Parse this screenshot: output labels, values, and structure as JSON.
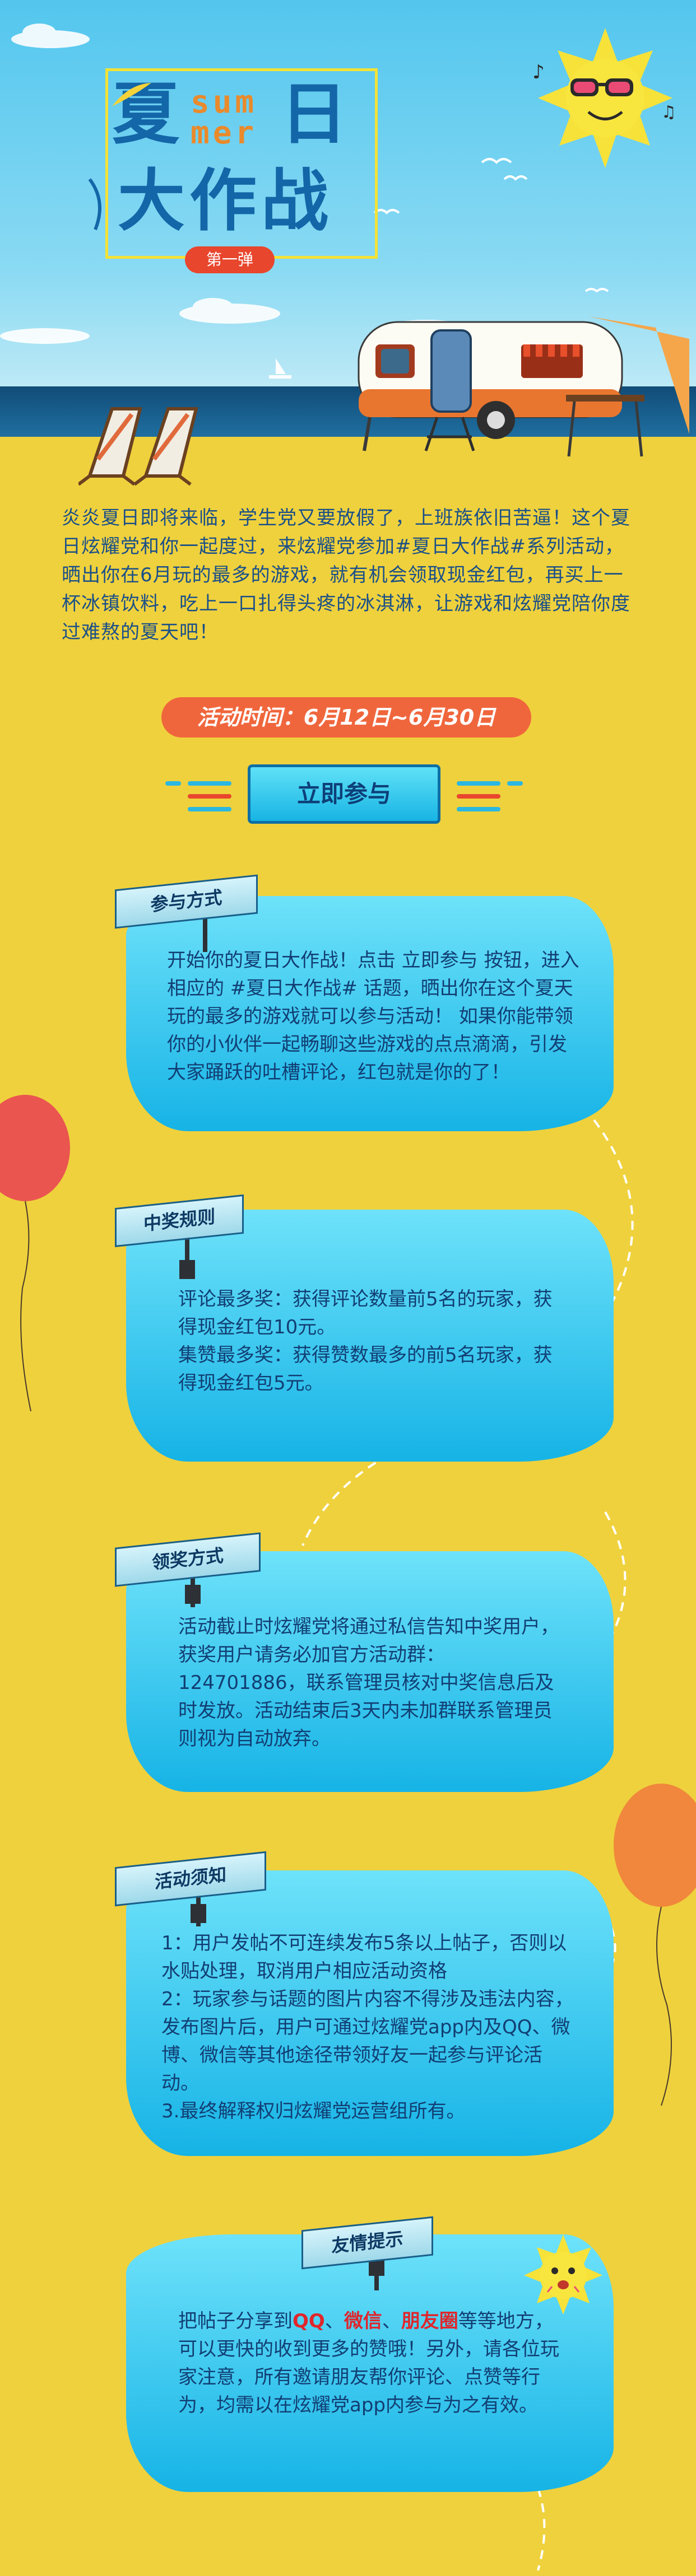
{
  "header": {
    "title_char1": "夏",
    "title_char2": "日",
    "title_line2": "大作战",
    "summer_line1": "sum",
    "summer_line2": "mer",
    "badge": "第一弹"
  },
  "intro": "炎炎夏日即将来临，学生党又要放假了，上班族依旧苦逼！这个夏日炫耀党和你一起度过，来炫耀党参加#夏日大作战#系列活动，晒出你在6月玩的最多的游戏，就有机会领取现金红包，再买上一杯冰镇饮料，吃上一口扎得头疼的冰淇淋，让游戏和炫耀党陪你度过难熬的夏天吧！",
  "activity_time": "活动时间：6月12日~6月30日",
  "join_button": "立即参与",
  "sections": [
    {
      "title": "参与方式",
      "text": "开始你的夏日大作战！点击 立即参与 按钮，进入相应的 #夏日大作战# 话题，晒出你在这个夏天玩的最多的游戏就可以参与活动！ 如果你能带领你的小伙伴一起畅聊这些游戏的点点滴滴，引发大家踊跃的吐槽评论，红包就是你的了！"
    },
    {
      "title": "中奖规则",
      "text": "评论最多奖：获得评论数量前5名的玩家，获得现金红包10元。\n集赞最多奖：获得赞数最多的前5名玩家，获得现金红包5元。"
    },
    {
      "title": "领奖方式",
      "text": "活动截止时炫耀党将通过私信告知中奖用户，获奖用户请务必加官方活动群：124701886，联系管理员核对中奖信息后及时发放。活动结束后3天内未加群联系管理员则视为自动放弃。"
    },
    {
      "title": "活动须知",
      "text": "1：用户发帖不可连续发布5条以上帖子，否则以水贴处理，取消用户相应活动资格\n2：玩家参与话题的图片内容不得涉及违法内容，发布图片后，用户可通过炫耀党app内及QQ、微博、微信等其他途径带领好友一起参与评论活动。\n3.最终解释权归炫耀党运营组所有。"
    }
  ],
  "tips": {
    "title": "友情提示",
    "text_before": "把帖子分享到",
    "channel_qq": "QQ",
    "sep1": "、",
    "channel_wechat": "微信",
    "sep2": "、",
    "channel_moments": "朋友圈",
    "text_after": "等等地方，可以更快的收到更多的赞哦！另外，请各位玩家注意，所有邀请朋友帮你评论、点赞等行为，均需以在炫耀党app内参与为之有效。"
  },
  "colors": {
    "sand": "#efd13d",
    "sky": "#53c6ee",
    "panel": "#2cc4ee",
    "title_blue": "#1366a7",
    "accent_orange": "#f0663c"
  }
}
